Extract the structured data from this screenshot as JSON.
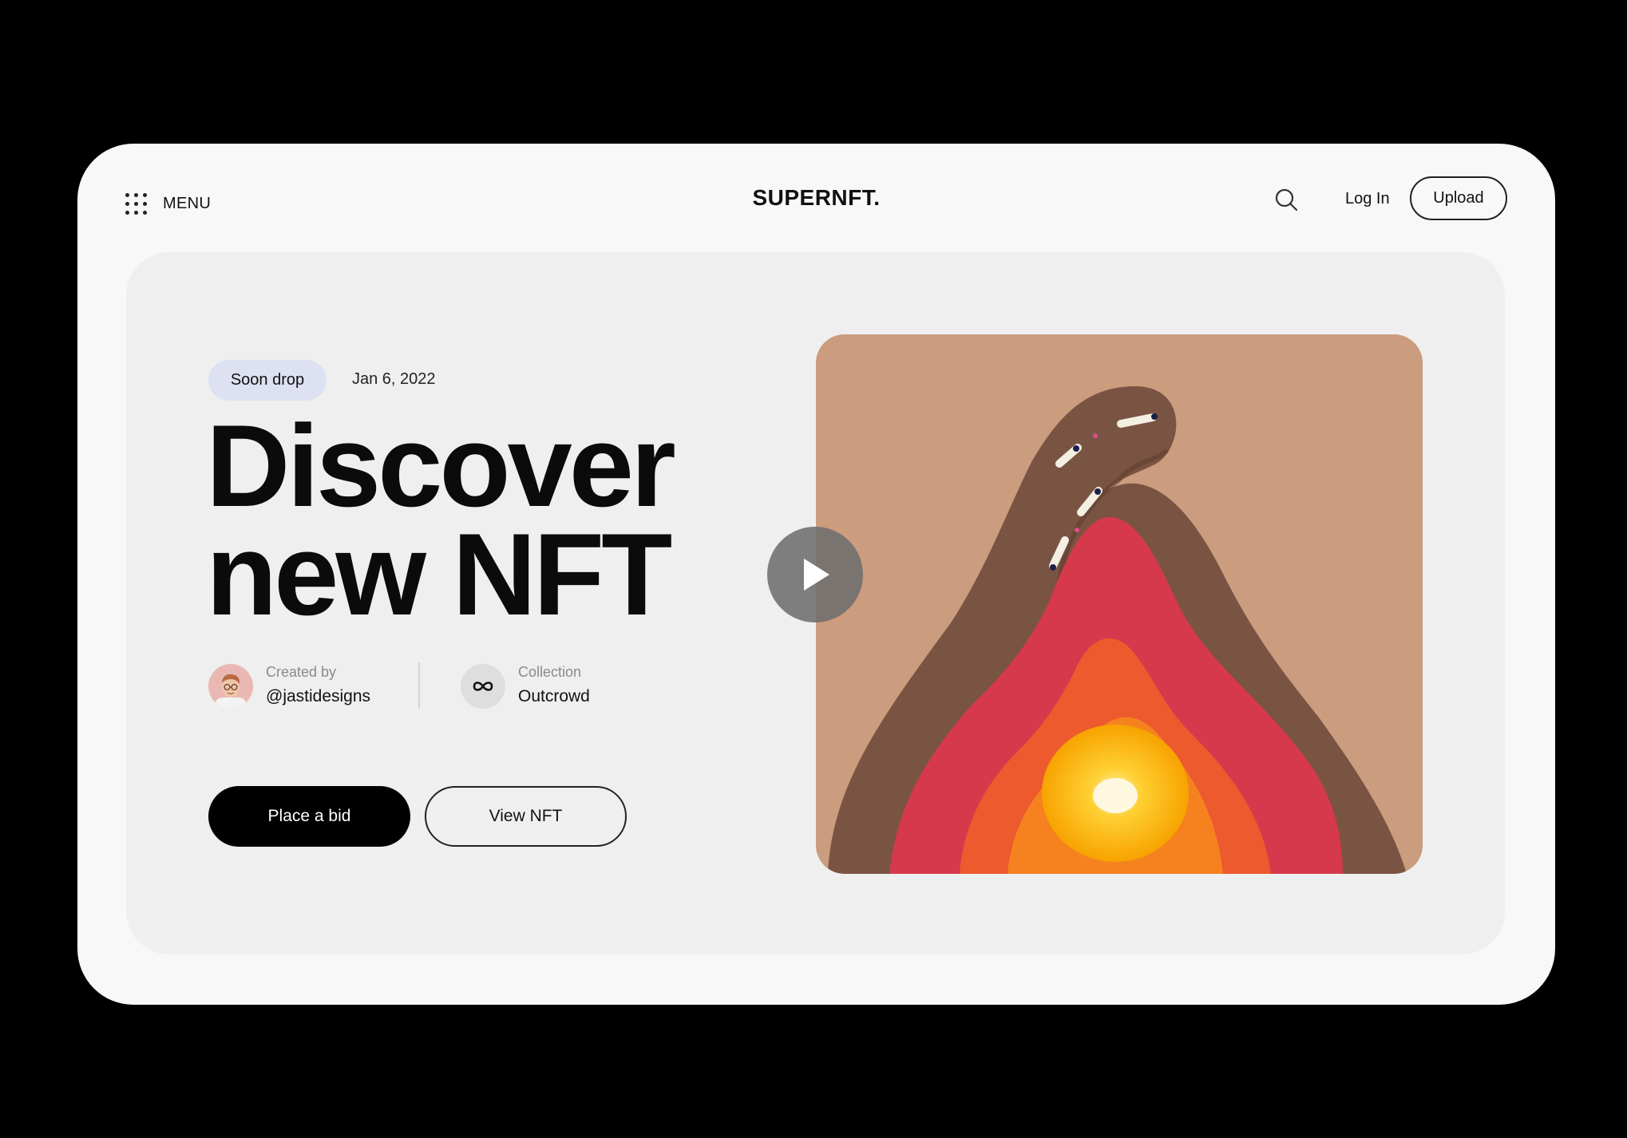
{
  "header": {
    "menu_label": "MENU",
    "brand": "SUPERNFT.",
    "login_label": "Log In",
    "upload_label": "Upload"
  },
  "hero": {
    "badge": "Soon drop",
    "date": "Jan 6, 2022",
    "headline_line1": "Discover",
    "headline_line2": "new NFT",
    "creator": {
      "label": "Created by",
      "value": "@jastidesigns"
    },
    "collection": {
      "label": "Collection",
      "value": "Outcrowd"
    },
    "bid_label": "Place a bid",
    "view_label": "View NFT"
  },
  "colors": {
    "background": "#000000",
    "card": "#f8f8f8",
    "hero_panel": "#efefef",
    "badge": "#dde1f2",
    "art_background": "#cb9c7d"
  },
  "icons": [
    "menu-dots-icon",
    "search-icon",
    "collection-infinity-icon",
    "play-icon"
  ]
}
